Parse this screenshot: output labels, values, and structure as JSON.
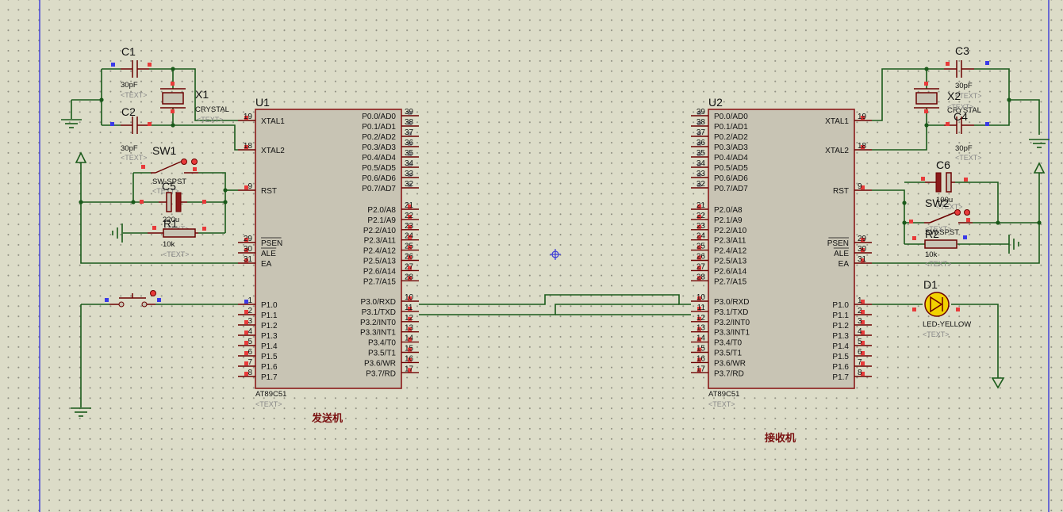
{
  "colors": {
    "background": "#dcdcc8",
    "wire": "#1a5a1a",
    "component_outline": "#8b1a1a",
    "pin_marker": "#e83a3a",
    "connect_marker": "#3a3ae8",
    "led_fill": "#f2d200",
    "label_red": "#7a1010"
  },
  "notes": {
    "sender": "发送机",
    "receiver": "接收机"
  },
  "u1": {
    "ref": "U1",
    "value": "AT89C51",
    "text": "<TEXT>",
    "left_pins": [
      {
        "num": "19",
        "label": "XTAL1"
      },
      {
        "num": "18",
        "label": "XTAL2"
      },
      {
        "num": "9",
        "label": "RST"
      },
      {
        "num": "29",
        "label": "PSEN"
      },
      {
        "num": "30",
        "label": "ALE"
      },
      {
        "num": "31",
        "label": "EA"
      },
      {
        "num": "1",
        "label": "P1.0"
      },
      {
        "num": "2",
        "label": "P1.1"
      },
      {
        "num": "3",
        "label": "P1.2"
      },
      {
        "num": "4",
        "label": "P1.3"
      },
      {
        "num": "5",
        "label": "P1.4"
      },
      {
        "num": "6",
        "label": "P1.5"
      },
      {
        "num": "7",
        "label": "P1.6"
      },
      {
        "num": "8",
        "label": "P1.7"
      }
    ],
    "right_pins": [
      {
        "num": "39",
        "label": "P0.0/AD0"
      },
      {
        "num": "38",
        "label": "P0.1/AD1"
      },
      {
        "num": "37",
        "label": "P0.2/AD2"
      },
      {
        "num": "36",
        "label": "P0.3/AD3"
      },
      {
        "num": "35",
        "label": "P0.4/AD4"
      },
      {
        "num": "34",
        "label": "P0.5/AD5"
      },
      {
        "num": "33",
        "label": "P0.6/AD6"
      },
      {
        "num": "32",
        "label": "P0.7/AD7"
      },
      {
        "num": "21",
        "label": "P2.0/A8"
      },
      {
        "num": "22",
        "label": "P2.1/A9"
      },
      {
        "num": "23",
        "label": "P2.2/A10"
      },
      {
        "num": "24",
        "label": "P2.3/A11"
      },
      {
        "num": "25",
        "label": "P2.4/A12"
      },
      {
        "num": "26",
        "label": "P2.5/A13"
      },
      {
        "num": "27",
        "label": "P2.6/A14"
      },
      {
        "num": "28",
        "label": "P2.7/A15"
      },
      {
        "num": "10",
        "label": "P3.0/RXD"
      },
      {
        "num": "11",
        "label": "P3.1/TXD"
      },
      {
        "num": "12",
        "label": "P3.2/INT0"
      },
      {
        "num": "13",
        "label": "P3.3/INT1"
      },
      {
        "num": "14",
        "label": "P3.4/T0"
      },
      {
        "num": "15",
        "label": "P3.5/T1"
      },
      {
        "num": "16",
        "label": "P3.6/WR"
      },
      {
        "num": "17",
        "label": "P3.7/RD"
      }
    ]
  },
  "u2": {
    "ref": "U2",
    "value": "AT89C51",
    "text": "<TEXT>",
    "left_pins": [
      {
        "num": "39",
        "label": "P0.0/AD0"
      },
      {
        "num": "38",
        "label": "P0.1/AD1"
      },
      {
        "num": "37",
        "label": "P0.2/AD2"
      },
      {
        "num": "36",
        "label": "P0.3/AD3"
      },
      {
        "num": "35",
        "label": "P0.4/AD4"
      },
      {
        "num": "34",
        "label": "P0.5/AD5"
      },
      {
        "num": "33",
        "label": "P0.6/AD6"
      },
      {
        "num": "32",
        "label": "P0.7/AD7"
      },
      {
        "num": "21",
        "label": "P2.0/A8"
      },
      {
        "num": "22",
        "label": "P2.1/A9"
      },
      {
        "num": "23",
        "label": "P2.2/A10"
      },
      {
        "num": "24",
        "label": "P2.3/A11"
      },
      {
        "num": "25",
        "label": "P2.4/A12"
      },
      {
        "num": "26",
        "label": "P2.5/A13"
      },
      {
        "num": "27",
        "label": "P2.6/A14"
      },
      {
        "num": "28",
        "label": "P2.7/A15"
      },
      {
        "num": "10",
        "label": "P3.0/RXD"
      },
      {
        "num": "11",
        "label": "P3.1/TXD"
      },
      {
        "num": "12",
        "label": "P3.2/INT0"
      },
      {
        "num": "13",
        "label": "P3.3/INT1"
      },
      {
        "num": "14",
        "label": "P3.4/T0"
      },
      {
        "num": "15",
        "label": "P3.5/T1"
      },
      {
        "num": "16",
        "label": "P3.6/WR"
      },
      {
        "num": "17",
        "label": "P3.7/RD"
      }
    ],
    "right_pins": [
      {
        "num": "19",
        "label": "XTAL1"
      },
      {
        "num": "18",
        "label": "XTAL2"
      },
      {
        "num": "9",
        "label": "RST"
      },
      {
        "num": "29",
        "label": "PSEN"
      },
      {
        "num": "30",
        "label": "ALE"
      },
      {
        "num": "31",
        "label": "EA"
      },
      {
        "num": "1",
        "label": "P1.0"
      },
      {
        "num": "2",
        "label": "P1.1"
      },
      {
        "num": "3",
        "label": "P1.2"
      },
      {
        "num": "4",
        "label": "P1.3"
      },
      {
        "num": "5",
        "label": "P1.4"
      },
      {
        "num": "6",
        "label": "P1.5"
      },
      {
        "num": "7",
        "label": "P1.6"
      },
      {
        "num": "8",
        "label": "P1.7"
      }
    ]
  },
  "parts": {
    "c1": {
      "ref": "C1",
      "value": "30pF",
      "text": "<TEXT>"
    },
    "c2": {
      "ref": "C2",
      "value": "30pF",
      "text": "<TEXT>"
    },
    "x1": {
      "ref": "X1",
      "value": "CRYSTAL",
      "text": "<TEXT>"
    },
    "sw1": {
      "ref": "SW1",
      "value": "SW-SPST",
      "text": "<TEXT>"
    },
    "c5": {
      "ref": "C5",
      "value": "220u",
      "text": "<TEXT>"
    },
    "r1": {
      "ref": "R1",
      "value": "10k",
      "text": "<TEXT>"
    },
    "c3": {
      "ref": "C3",
      "value": "30pF",
      "text": "<TEXT>"
    },
    "c4": {
      "ref": "C4",
      "value": "30pF",
      "text": "<TEXT>"
    },
    "x2": {
      "ref": "X2",
      "value": "CRYSTAL",
      "text": "<TEXT>"
    },
    "c6": {
      "ref": "C6",
      "value": "100u",
      "text": "<TEXT>"
    },
    "sw2": {
      "ref": "SW2",
      "value": "SW-SPST",
      "text": "<TEXT>"
    },
    "r2": {
      "ref": "R2",
      "value": "10k",
      "text": "<TEXT>"
    },
    "d1": {
      "ref": "D1",
      "value": "LED-YELLOW",
      "text": "<TEXT>"
    }
  }
}
